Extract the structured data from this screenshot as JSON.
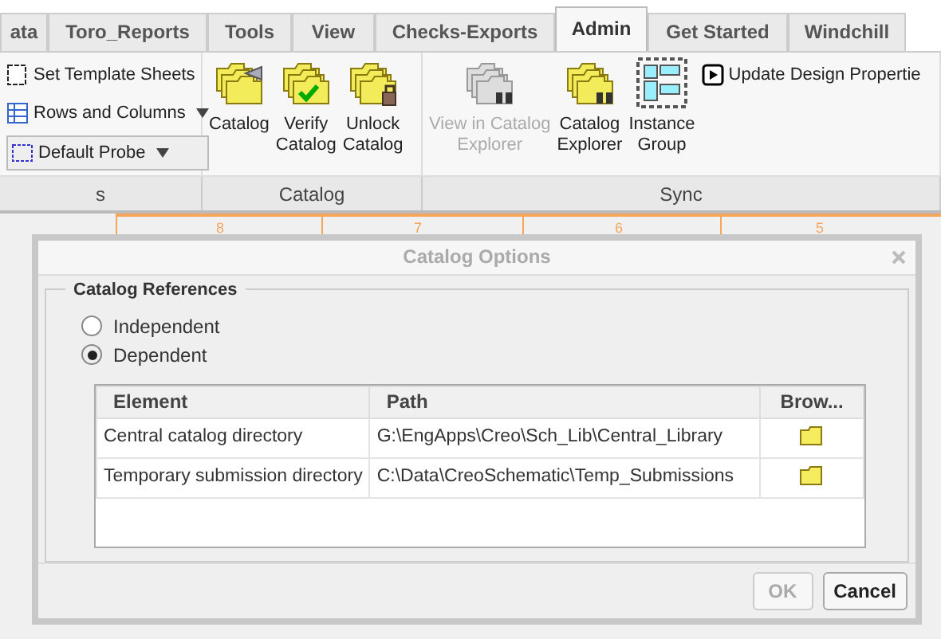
{
  "tabs": [
    {
      "label": "ata",
      "selected": false
    },
    {
      "label": "Toro_Reports",
      "selected": false
    },
    {
      "label": "Tools",
      "selected": false
    },
    {
      "label": "View",
      "selected": false
    },
    {
      "label": "Checks-Exports",
      "selected": false
    },
    {
      "label": "Admin",
      "selected": true
    },
    {
      "label": "Get Started",
      "selected": false
    },
    {
      "label": "Windchill",
      "selected": false
    }
  ],
  "ribbon": {
    "groups": [
      {
        "label": "s",
        "items": [
          {
            "kind": "small",
            "label": "Set Template Sheets",
            "disabled": false
          },
          {
            "kind": "small",
            "label": "Rows and Columns",
            "disabled": false,
            "caret": true
          },
          {
            "kind": "dropdown",
            "label": "Default Probe",
            "disabled": false
          }
        ]
      },
      {
        "label": "Catalog",
        "items": [
          {
            "kind": "large",
            "label": "Catalog",
            "disabled": false
          },
          {
            "kind": "large",
            "label": "Verify\nCatalog",
            "disabled": false
          },
          {
            "kind": "large",
            "label": "Unlock\nCatalog",
            "disabled": false
          }
        ]
      },
      {
        "label": "Sync",
        "items": [
          {
            "kind": "large",
            "label": "View in Catalog\nExplorer",
            "disabled": true
          },
          {
            "kind": "large",
            "label": "Catalog\nExplorer",
            "disabled": false
          },
          {
            "kind": "large",
            "label": "Instance\nGroup",
            "disabled": false
          },
          {
            "kind": "small",
            "label": "Update Design Propertie",
            "disabled": false
          }
        ]
      }
    ]
  },
  "drawing": {
    "ruler_labels": [
      "8",
      "7",
      "6",
      "5"
    ]
  },
  "dialog": {
    "title": "Catalog Options",
    "group": {
      "legend": "Catalog References",
      "options": [
        {
          "label": "Independent",
          "selected": false
        },
        {
          "label": "Dependent",
          "selected": true
        }
      ],
      "table": {
        "columns": [
          "Element",
          "Path",
          "Brow..."
        ],
        "rows": [
          {
            "element": "Central catalog directory",
            "path": "G:\\EngApps\\Creo\\Sch_Lib\\Central_Library"
          },
          {
            "element": "Temporary submission directory",
            "path": "C:\\Data\\CreoSchematic\\Temp_Submissions"
          }
        ]
      }
    },
    "buttons": [
      {
        "label": "OK",
        "disabled": true
      },
      {
        "label": "Cancel",
        "disabled": false
      }
    ]
  }
}
